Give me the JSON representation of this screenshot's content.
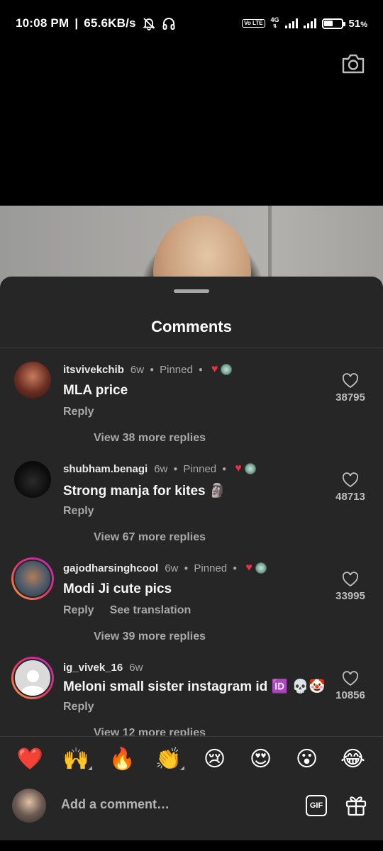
{
  "status_bar": {
    "time": "10:08 PM",
    "separator": "|",
    "speed": "65.6KB/s",
    "volte": "Vo LTE",
    "network": "4G",
    "battery": "51",
    "battery_unit": "%",
    "battery_level": 0.51,
    "icons": [
      "muted-bell-icon",
      "headphones-icon",
      "signal-icon",
      "battery-icon"
    ]
  },
  "camera_icon": "camera-icon",
  "sheet": {
    "title": "Comments"
  },
  "comments": [
    {
      "username": "itsvivekchib",
      "age": "6w",
      "pinned": "Pinned",
      "text": "MLA price",
      "reply": "Reply",
      "translation": "",
      "view_more": "View 38 more replies",
      "likes": "38795",
      "creator_liked": true
    },
    {
      "username": "shubham.benagi",
      "age": "6w",
      "pinned": "Pinned",
      "text": "Strong manja for kites 🗿",
      "reply": "Reply",
      "translation": "",
      "view_more": "View 67 more replies",
      "likes": "48713",
      "creator_liked": true
    },
    {
      "username": "gajodharsinghcool",
      "age": "6w",
      "pinned": "Pinned",
      "text": "Modi Ji cute pics",
      "reply": "Reply",
      "translation": "See translation",
      "view_more": "View 39 more replies",
      "likes": "33995",
      "creator_liked": true
    },
    {
      "username": "ig_vivek_16",
      "age": "6w",
      "pinned": "",
      "text": "Meloni small sister instagram id 🆔 💀🤡",
      "reply": "Reply",
      "translation": "",
      "view_more": "View 12 more replies",
      "likes": "10856",
      "creator_liked": false
    }
  ],
  "emoji_bar": [
    "❤️",
    "🙌",
    "🔥",
    "👏",
    "😢",
    "😍",
    "😮",
    "😂"
  ],
  "composer": {
    "placeholder": "Add a comment…",
    "gif_label": "GIF",
    "gift_icon": "gift-icon"
  },
  "colors": {
    "sheet_bg": "#262626",
    "secondary_text": "#a8a8a8",
    "heart_red": "#ed2f45"
  }
}
